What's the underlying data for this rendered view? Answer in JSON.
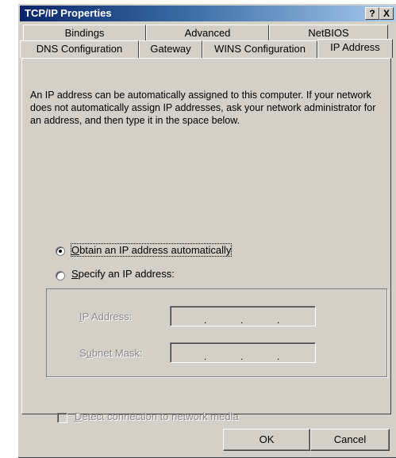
{
  "window": {
    "title": "TCP/IP Properties",
    "help_label": "?",
    "close_label": "X"
  },
  "tabs": {
    "row1": [
      {
        "label": "Bindings"
      },
      {
        "label": "Advanced"
      },
      {
        "label": "NetBIOS"
      }
    ],
    "row2": [
      {
        "label": "DNS Configuration"
      },
      {
        "label": "Gateway"
      },
      {
        "label": "WINS Configuration"
      },
      {
        "label": "IP Address",
        "active": true
      }
    ]
  },
  "content": {
    "description": "An IP address can be automatically assigned to this computer. If your network does not automatically assign IP addresses, ask your network administrator for an address, and then type it in the space below.",
    "obtain_auto": {
      "accel": "O",
      "rest": "btain an IP address automatically",
      "selected": true
    },
    "specify": {
      "accel": "S",
      "rest": "pecify an IP address:",
      "selected": false
    },
    "ip_address": {
      "accel": "I",
      "rest": "P Address:"
    },
    "subnet_mask": {
      "pre": "S",
      "accel": "u",
      "rest": "bnet Mask:"
    },
    "detect": {
      "accel": "D",
      "rest": "etect connection to network media",
      "checked": false
    }
  },
  "buttons": {
    "ok": "OK",
    "cancel": "Cancel"
  }
}
